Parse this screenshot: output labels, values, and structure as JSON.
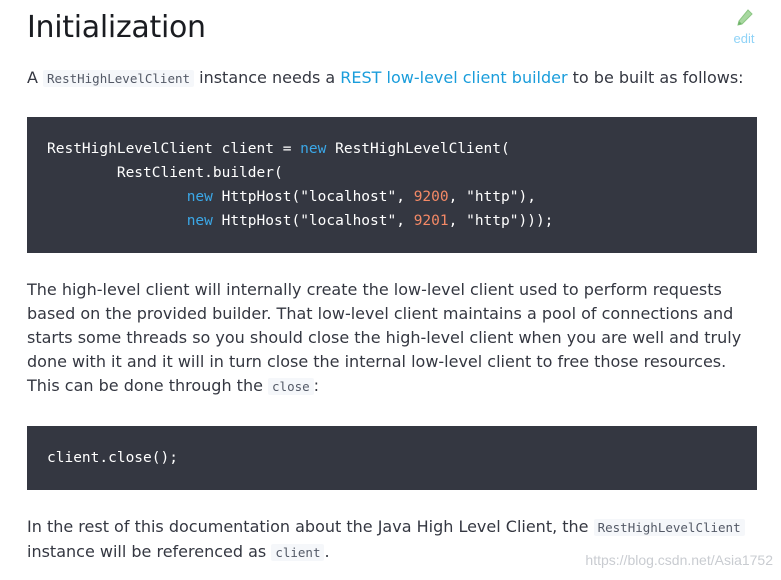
{
  "heading": "Initialization",
  "edit_label": "edit",
  "intro": {
    "prefix": "A ",
    "code": "RestHighLevelClient",
    "middle": " instance needs a ",
    "link": "REST low-level client builder",
    "suffix": " to be built as follows:"
  },
  "code1": {
    "line1": {
      "a": "RestHighLevelClient client = ",
      "kw": "new",
      "b": " RestHighLevelClient("
    },
    "line2": "        RestClient.builder(",
    "line3": {
      "indent": "                ",
      "kw": "new",
      "a": " HttpHost(",
      "s1": "\"localhost\"",
      "c1": ", ",
      "n": "9200",
      "c2": ", ",
      "s2": "\"http\"",
      "end": "),"
    },
    "line4": {
      "indent": "                ",
      "kw": "new",
      "a": " HttpHost(",
      "s1": "\"localhost\"",
      "c1": ", ",
      "n": "9201",
      "c2": ", ",
      "s2": "\"http\"",
      "end": ")));"
    }
  },
  "para2": {
    "text": "The high-level client will internally create the low-level client used to perform requests based on the provided builder. That low-level client maintains a pool of connections and starts some threads so you should close the high-level client when you are well and truly done with it and it will in turn close the internal low-level client to free those resources. This can be done through the ",
    "code": "close",
    "suffix": ":"
  },
  "code2": {
    "line1": "client.close();"
  },
  "para3": {
    "prefix": "In the rest of this documentation about the Java High Level Client, the ",
    "code1": "RestHighLevelClient",
    "middle": " instance will be referenced as ",
    "code2": "client",
    "suffix": "."
  },
  "watermark": "https://blog.csdn.net/Asia1752",
  "colors": {
    "code_bg": "#343741",
    "keyword": "#3ba8e8",
    "number": "#f48966",
    "link": "#1a9ddb"
  }
}
